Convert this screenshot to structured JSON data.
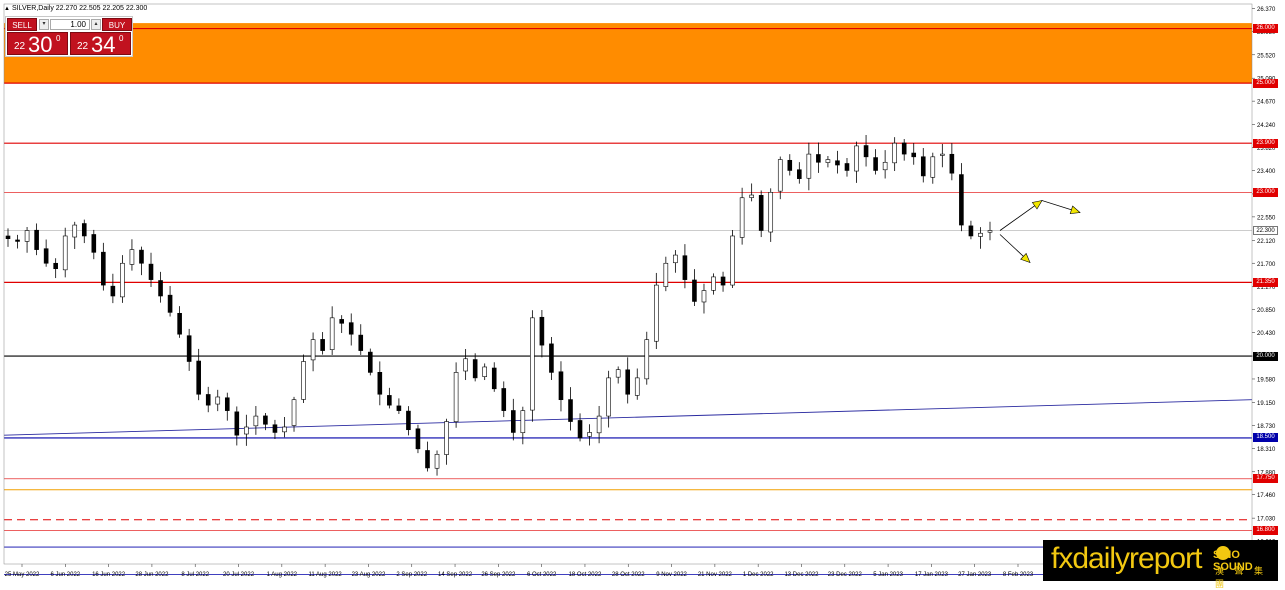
{
  "header": {
    "symbol_line": "SILVER,Daily  22.270 22.505 22.205 22.300"
  },
  "trade_panel": {
    "sell_label": "SELL",
    "buy_label": "BUY",
    "lot": "1.00",
    "sell_small": "22",
    "sell_big": "30",
    "sell_sup": "0",
    "buy_small": "22",
    "buy_big": "34",
    "buy_sup": "0"
  },
  "brand": {
    "text": "fxdailyreport",
    "logo_text": "SINO SOUND",
    "logo_sub": "漢 聲 集 團"
  },
  "colors": {
    "orange": "#ff8c00",
    "red": "#e00000",
    "blue": "#0000aa",
    "candle": "#000000",
    "arrow": "#f2e600"
  },
  "chart_data": {
    "type": "candlestick",
    "symbol": "SILVER",
    "timeframe": "Daily",
    "ohlc_current": {
      "open": 22.27,
      "high": 22.505,
      "low": 22.205,
      "close": 22.3
    },
    "ylim": [
      16.19,
      26.45
    ],
    "y_ticks": [
      "26.370",
      "25.950",
      "25.520",
      "25.090",
      "24.670",
      "24.240",
      "23.820",
      "23.400",
      "22.970",
      "22.550",
      "22.120",
      "21.700",
      "21.270",
      "20.850",
      "20.430",
      "20.000",
      "19.580",
      "19.150",
      "18.730",
      "18.310",
      "17.880",
      "17.460",
      "17.030",
      "16.610"
    ],
    "x_ticks": [
      "25 May 2022",
      "6 Jun 2022",
      "16 Jun 2022",
      "28 Jun 2022",
      "8 Jul 2022",
      "20 Jul 2022",
      "1 Aug 2022",
      "11 Aug 2022",
      "23 Aug 2022",
      "2 Sep 2022",
      "14 Sep 2022",
      "26 Sep 2022",
      "6 Oct 2022",
      "18 Oct 2022",
      "28 Oct 2022",
      "9 Nov 2022",
      "21 Nov 2022",
      "1 Dec 2022",
      "13 Dec 2022",
      "23 Dec 2022",
      "5 Jan 2023",
      "17 Jan 2023",
      "27 Jan 2023",
      "8 Feb 2023"
    ],
    "close_path": [
      22.15,
      22.1,
      22.3,
      21.95,
      21.7,
      21.6,
      22.2,
      22.4,
      22.2,
      21.9,
      21.3,
      21.1,
      21.7,
      21.95,
      21.7,
      21.4,
      21.1,
      20.8,
      20.4,
      19.9,
      19.3,
      19.1,
      19.25,
      19.0,
      18.55,
      18.7,
      18.9,
      18.75,
      18.6,
      18.7,
      19.2,
      19.9,
      20.3,
      20.1,
      20.7,
      20.6,
      20.4,
      20.1,
      19.7,
      19.3,
      19.1,
      19.0,
      18.65,
      18.3,
      17.95,
      18.2,
      18.8,
      19.7,
      19.95,
      19.6,
      19.8,
      19.4,
      19.0,
      18.6,
      19.0,
      20.7,
      20.2,
      19.7,
      19.2,
      18.8,
      18.5,
      18.6,
      18.9,
      19.6,
      19.75,
      19.3,
      19.6,
      20.3,
      21.3,
      21.7,
      21.85,
      21.4,
      21.0,
      21.2,
      21.45,
      21.3,
      22.2,
      22.9,
      22.95,
      22.3,
      23.0,
      23.6,
      23.4,
      23.25,
      23.7,
      23.55,
      23.6,
      23.5,
      23.4,
      23.85,
      23.65,
      23.4,
      23.55,
      23.9,
      23.7,
      23.65,
      23.3,
      23.65,
      23.7,
      23.35,
      22.4,
      22.2,
      22.25,
      22.3
    ],
    "annotation_arrows": [
      {
        "direction": "up",
        "color": "yellow"
      },
      {
        "direction": "down",
        "color": "yellow"
      }
    ],
    "levels": [
      {
        "value": 26.0,
        "label": "26.000",
        "color": "#e00000",
        "width": 1.2
      },
      {
        "value": 25.0,
        "label": "25.000",
        "color": "#e00000",
        "width": 1.2
      },
      {
        "value": 23.9,
        "label": "23.900",
        "color": "#e00000",
        "width": 1.2
      },
      {
        "value": 23.0,
        "label": "23.000",
        "color": "#e00000",
        "width": 0.6
      },
      {
        "value": 22.3,
        "label": "22.300",
        "color": "#9a9a9a",
        "width": 0.6,
        "current": true
      },
      {
        "value": 21.35,
        "label": "21.350",
        "color": "#e00000",
        "width": 1.2
      },
      {
        "value": 20.0,
        "label": "20.000",
        "color": "#000000",
        "width": 1.2
      },
      {
        "value": 18.5,
        "label": "18.500",
        "color": "#0000aa",
        "width": 1.2
      },
      {
        "value": 17.75,
        "label": "17.750",
        "color": "#e00000",
        "width": 0.6
      },
      {
        "value": 17.55,
        "label": "",
        "color": "#f2a000",
        "width": 1
      },
      {
        "value": 17.0,
        "label": "",
        "color": "#e00000",
        "width": 1,
        "dashed": true
      },
      {
        "value": 16.8,
        "label": "16.800",
        "color": "#e00000",
        "width": 0.6
      },
      {
        "value": 16.5,
        "label": "16.500",
        "color": "#0000aa",
        "width": 0.8
      },
      {
        "value": 16.0,
        "label": "",
        "color": "#0000aa",
        "width": 0.8
      }
    ],
    "zone": {
      "from": 25.0,
      "to": 26.1,
      "color": "#ff8c00"
    },
    "trendline": {
      "from": 18.55,
      "to": 19.2,
      "color": "#2a2aa0"
    }
  }
}
